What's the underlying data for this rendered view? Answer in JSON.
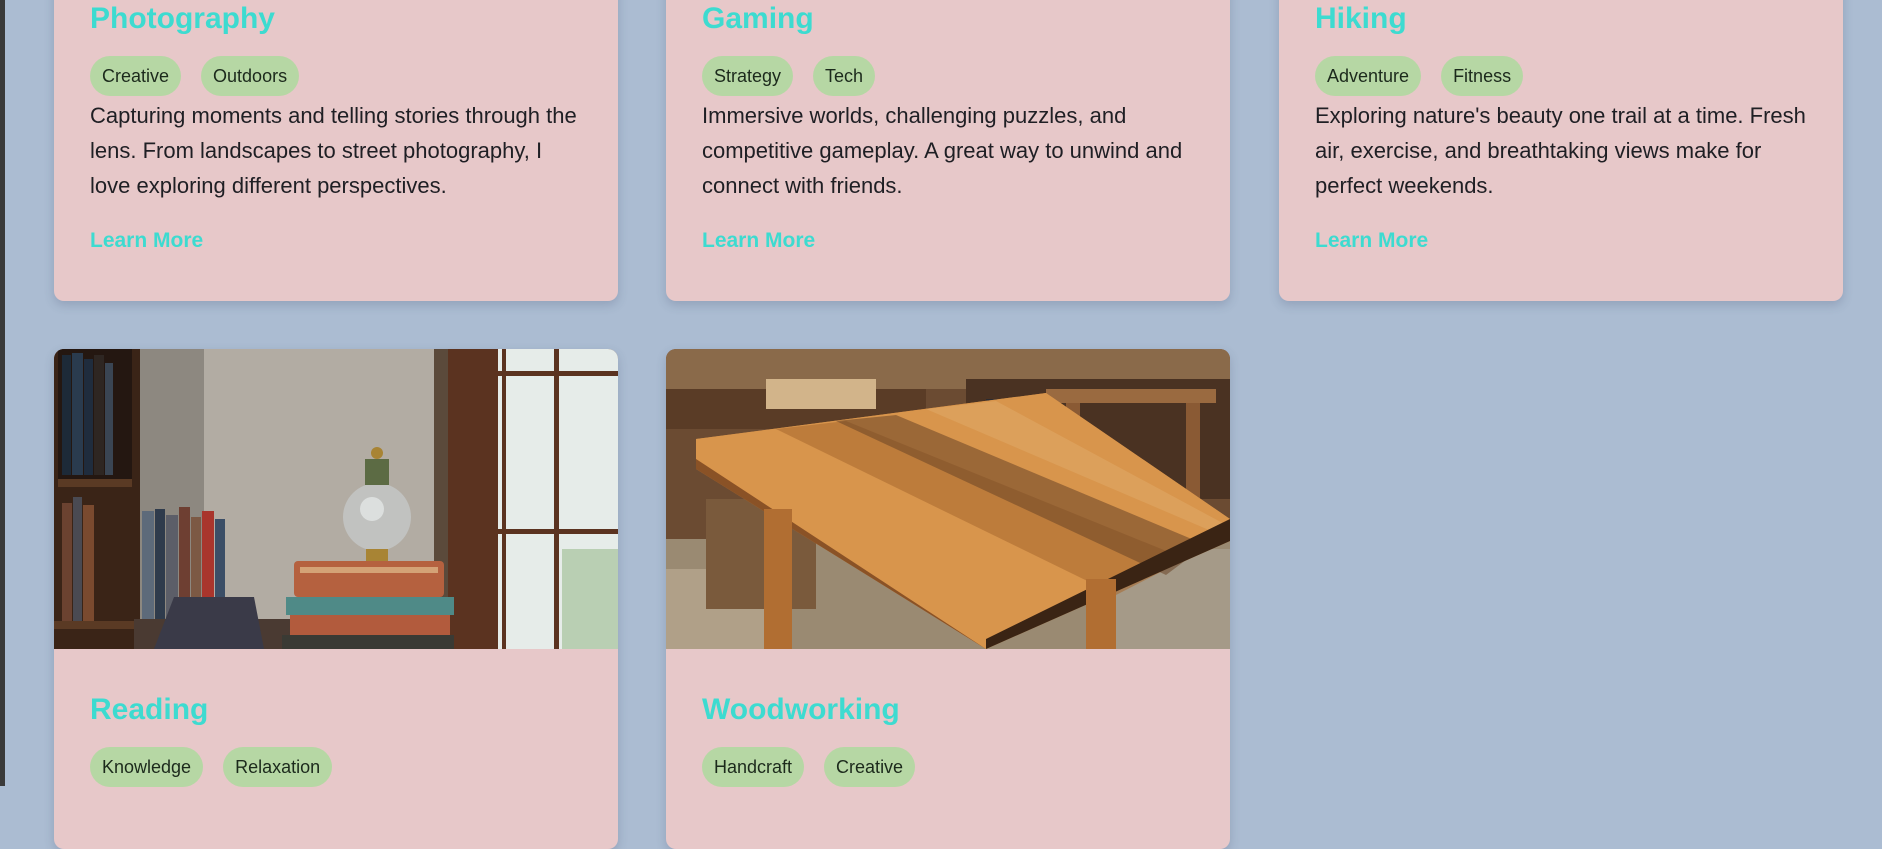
{
  "cards": [
    {
      "title": "Photography",
      "tags": [
        "Creative",
        "Outdoors"
      ],
      "description": "Capturing moments and telling stories through the lens. From landscapes to street photography, I love exploring different perspectives.",
      "link": "Learn More"
    },
    {
      "title": "Gaming",
      "tags": [
        "Strategy",
        "Tech"
      ],
      "description": "Immersive worlds, challenging puzzles, and competitive gameplay. A great way to unwind and connect with friends.",
      "link": "Learn More"
    },
    {
      "title": "Hiking",
      "tags": [
        "Adventure",
        "Fitness"
      ],
      "description": "Exploring nature's beauty one trail at a time. Fresh air, exercise, and breathtaking views make for perfect weekends.",
      "link": "Learn More"
    },
    {
      "title": "Reading",
      "tags": [
        "Knowledge",
        "Relaxation"
      ]
    },
    {
      "title": "Woodworking",
      "tags": [
        "Handcraft",
        "Creative"
      ]
    }
  ],
  "colors": {
    "page_background": "#abbcd2",
    "card_background": "#e7c8c9",
    "accent": "#3ddbd0",
    "tag_background": "#b6d7a4"
  }
}
